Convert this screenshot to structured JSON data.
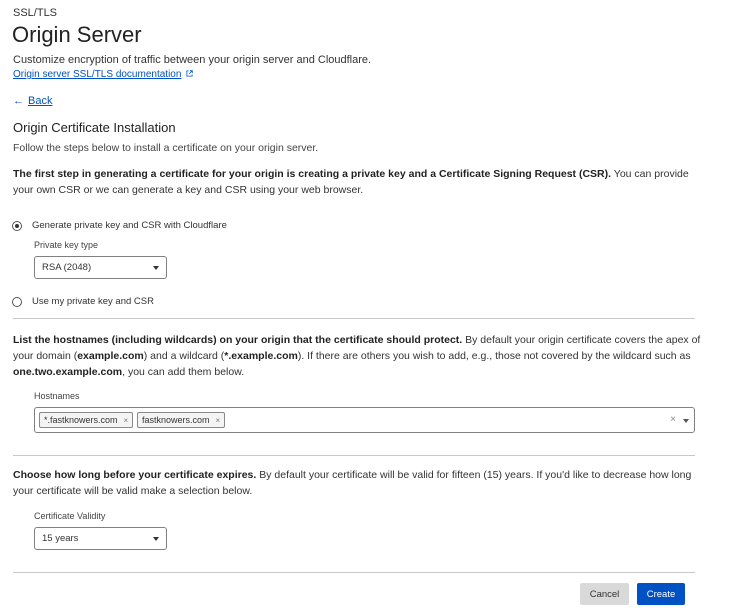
{
  "header": {
    "breadcrumb": "SSL/TLS",
    "title": "Origin Server",
    "subtitle": "Customize encryption of traffic between your origin server and Cloudflare.",
    "doc_link": "Origin server SSL/TLS documentation"
  },
  "nav": {
    "back_label": "Back"
  },
  "section": {
    "title": "Origin Certificate Installation",
    "instructions": "Follow the steps below to install a certificate on your origin server."
  },
  "step1": {
    "bold": "The first step in generating a certificate for your origin is creating a private key and a Certificate Signing Request (CSR).",
    "rest": " You can provide your own CSR or we can generate a key and CSR using your web browser.",
    "option_generate": "Generate private key and CSR with Cloudflare",
    "option_generate_selected": true,
    "key_type_label": "Private key type",
    "key_type_value": "RSA (2048)",
    "option_own": "Use my private key and CSR"
  },
  "step2": {
    "bold": "List the hostnames (including wildcards) on your origin that the certificate should protect.",
    "t1": " By default your origin certificate covers the apex of your domain (",
    "b1": "example.com",
    "t2": ") and a wildcard (",
    "b2": "*.example.com",
    "t3": "). If there are others you wish to add, e.g., those not covered by the wildcard such as ",
    "b3": "one.two.example.com",
    "t4": ", you can add them below.",
    "hostnames_label": "Hostnames",
    "hostnames": [
      "*.fastknowers.com",
      "fastknowers.com"
    ],
    "chip_remove": "×",
    "clear_icon": "×"
  },
  "step3": {
    "bold": "Choose how long before your certificate expires.",
    "rest": " By default your certificate will be valid for fifteen (15) years. If you'd like to decrease how long your certificate will be valid make a selection below.",
    "validity_label": "Certificate Validity",
    "validity_value": "15 years"
  },
  "actions": {
    "cancel": "Cancel",
    "create": "Create"
  },
  "colors": {
    "link": "#0051c3",
    "primary_button": "#0051c3",
    "secondary_button": "#d9d9d9"
  }
}
